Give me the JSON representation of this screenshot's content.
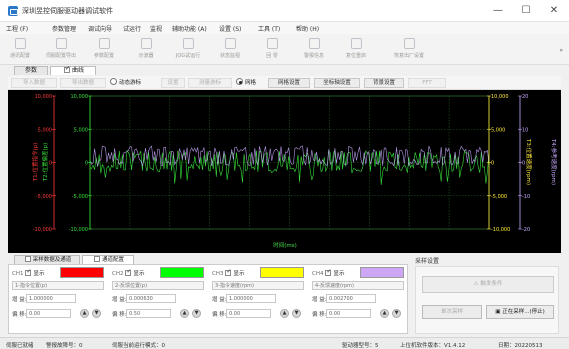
{
  "window": {
    "title": "深圳昱控伺服驱动器调试软件",
    "minimize": "—",
    "maximize": "☐",
    "close": "✕"
  },
  "menu": [
    "工程 (F)",
    "参数管理",
    "调试向导",
    "试运行",
    "监视",
    "辅助功能 (A)",
    "设置 (S)",
    "工具 (T)",
    "帮助 (H)"
  ],
  "toolbar": [
    {
      "label": "通讯配置",
      "icon": "plug-icon"
    },
    {
      "label": "伺服配置导出",
      "icon": "export-icon"
    },
    {
      "label": "参数配置",
      "icon": "params-icon"
    },
    {
      "label": "示波器",
      "icon": "scope-icon"
    },
    {
      "label": "JOG试运行",
      "icon": "jog-icon"
    },
    {
      "label": "状态监视",
      "icon": "monitor-icon"
    },
    {
      "label": "回 零",
      "icon": "home-icon"
    },
    {
      "label": "警报信息",
      "icon": "alarm-icon"
    },
    {
      "label": "复位重启",
      "icon": "power-icon"
    },
    {
      "label": "恢复出厂设置",
      "icon": "factory-reset-icon"
    }
  ],
  "toolbar_more": "»",
  "subtabs": {
    "params": "参数",
    "chart": "曲线"
  },
  "chart_controls": {
    "import": "导入数据",
    "export": "导出数据",
    "dynamic_cursor": "动态游标",
    "settings": "设置",
    "measure_cursor": "测量游标",
    "grid": "网格",
    "grid_settings": "网格设置",
    "axis_config": "坐标轴设置",
    "background": "背景设置",
    "fft": "FFT"
  },
  "chart_data": {
    "type": "line",
    "xlabel": "时间(ms)",
    "grid": true,
    "axes": {
      "left_outer": {
        "label": "T1:位置指令(p)",
        "ylim": [
          -10000,
          10000
        ],
        "color": "#ff3b3b"
      },
      "left_inner": {
        "label": "T2:位置偏差(p)",
        "ylim": [
          -10000,
          10000
        ],
        "color": "#36e03a"
      },
      "right_inner": {
        "label": "T3:位置速度(rpm)",
        "ylim": [
          -10000,
          10000
        ],
        "color": "#ffe93b"
      },
      "right_outer": {
        "label": "T4:参考速度(rpm)",
        "ylim": [
          -20,
          20
        ],
        "color": "#c9a9ff"
      }
    },
    "ticks": {
      "left_outer": [
        "10,000",
        "5,000",
        "0",
        "-5,000",
        "-10,000"
      ],
      "left_inner": [
        "10,000",
        "5,000",
        "0",
        "-5,000",
        "-10,000"
      ],
      "right_inner": [
        "10,000",
        "5,000",
        "0",
        "-5,000",
        "-10,000"
      ],
      "right_outer": [
        "20",
        "10",
        "0",
        "-10",
        "-20"
      ]
    },
    "series": [
      {
        "name": "T2:位置偏差(p)",
        "axis": "left_inner",
        "color": "#36e03a",
        "min": -1400,
        "max": 1800,
        "spike_min": -3400
      },
      {
        "name": "T4:参考速度(rpm)",
        "axis": "right_outer",
        "color": "#c9a9ff",
        "min": -1,
        "max": 5
      }
    ]
  },
  "bottom_tabs": {
    "sampling_source": "采样数据及通道",
    "channel_config": "通道配置"
  },
  "channels": [
    {
      "id": "CH1",
      "show": "显示",
      "color": "#ff0000",
      "source": "1-指令位置(p)",
      "gain_label": "增 益:",
      "gain": "1.000000",
      "offset_label": "偏 移:",
      "offset": "0.00"
    },
    {
      "id": "CH2",
      "show": "显示",
      "color": "#00ff00",
      "source": "2-反馈位置(p)",
      "gain_label": "增 益:",
      "gain": "0.000630",
      "offset_label": "偏 移:",
      "offset": "0.50"
    },
    {
      "id": "CH3",
      "show": "显示",
      "color": "#ffff00",
      "source": "3-指令速度(rpm)",
      "gain_label": "增 益:",
      "gain": "1.000000",
      "offset_label": "偏 移:",
      "offset": "0.00"
    },
    {
      "id": "CH4",
      "show": "显示",
      "color": "#cda6f5",
      "source": "4-反馈速度(rpm)",
      "gain_label": "增 益:",
      "gain": "0.002700",
      "offset_label": "偏 移:",
      "offset": "0.00"
    }
  ],
  "sampling": {
    "title": "采样设置",
    "trigger": "触发条件",
    "single": "单次采样",
    "status": "正在采样...(停止)"
  },
  "status": {
    "connected": "伺服已就绪",
    "alarm": "警报故障号：0",
    "mode": "伺服当前运行模式：0",
    "model": "驱动器型号：5",
    "version": "上位机软件版本：V1.4.12",
    "date": "日期：20220513"
  }
}
